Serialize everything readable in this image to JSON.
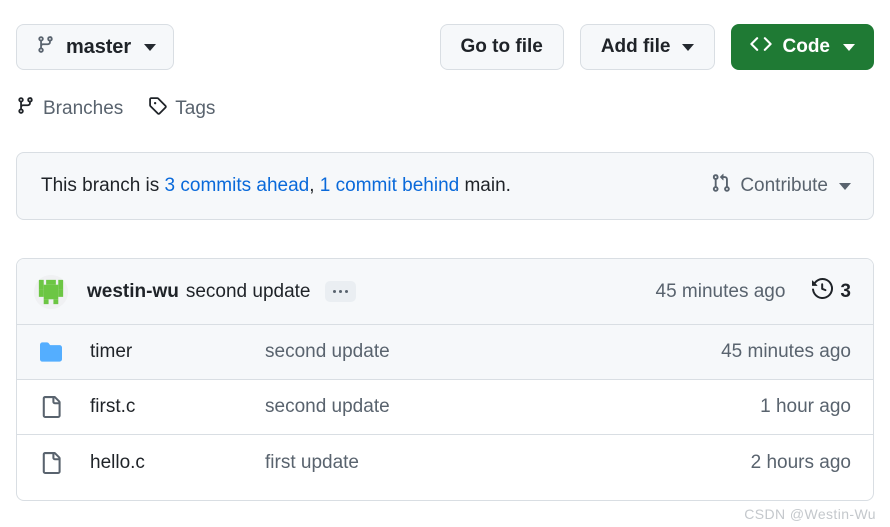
{
  "toolbar": {
    "branch_selector": {
      "label": "master",
      "icon": "git-branch-icon",
      "caret": "chevron-down-icon"
    },
    "buttons": [
      {
        "label": "Go to file",
        "kind": "default"
      },
      {
        "label": "Add file",
        "kind": "default",
        "caret": true
      },
      {
        "label": "Code",
        "kind": "primary",
        "icon": "code-brackets-icon",
        "caret": true
      }
    ]
  },
  "meta_row": {
    "branches": {
      "label": "Branches",
      "icon": "git-branch-icon"
    },
    "tags": {
      "label": "Tags",
      "icon": "tag-icon"
    }
  },
  "banner": {
    "prefix": "This branch is ",
    "ahead_link": "3 commits ahead",
    "separator": ", ",
    "behind_link": "1 commit behind",
    "suffix": " main.",
    "contribute": {
      "label": "Contribute",
      "icon": "git-pull-request-icon",
      "caret": "chevron-down-icon"
    }
  },
  "commit_header": {
    "avatar": "user-avatar-identicon",
    "author": "westin-wu",
    "message": "second update",
    "expand_label": "...",
    "relative_time": "45 minutes ago",
    "history": {
      "icon": "history-clock-icon",
      "count": "3"
    }
  },
  "file_table": {
    "rows": [
      {
        "icon": "folder-icon",
        "type": "directory",
        "name": "timer",
        "commit_message": "second update",
        "relative_time": "45 minutes ago",
        "highlight": true
      },
      {
        "icon": "file-icon",
        "type": "file",
        "name": "first.c",
        "commit_message": "second update",
        "relative_time": "1 hour ago",
        "highlight": false
      },
      {
        "icon": "file-icon",
        "type": "file",
        "name": "hello.c",
        "commit_message": "first update",
        "relative_time": "2 hours ago",
        "highlight": false
      }
    ]
  },
  "watermark": {
    "text": "CSDN @Westin-Wu"
  },
  "colors": {
    "primary_green": "#1f7a34",
    "link_blue": "#0969da",
    "muted_text": "#59636e",
    "border": "#d9dee3",
    "surface": "#f6f8fa",
    "folder_blue": "#54aeff",
    "avatar_green": "#6cc644"
  }
}
